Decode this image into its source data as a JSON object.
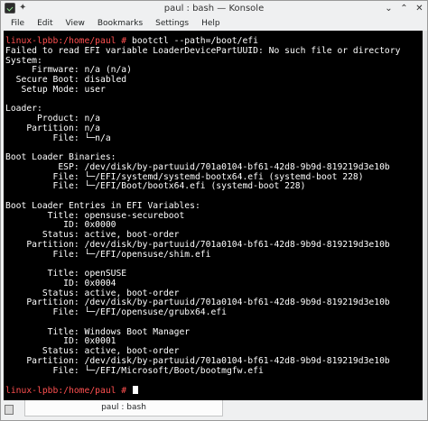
{
  "window": {
    "title": "paul : bash — Konsole",
    "min_glyph": "⌄",
    "max_glyph": "⌃",
    "close_glyph": "✕",
    "pin_glyph": "✦"
  },
  "menu": [
    "File",
    "Edit",
    "View",
    "Bookmarks",
    "Settings",
    "Help"
  ],
  "terminal": {
    "background": "#000000",
    "foreground": "#ffffff",
    "prompt_color": "#ff5050",
    "lines": [
      {
        "prompt": "linux-lpbb:/home/paul #",
        "text": " bootctl --path=/boot/efi"
      },
      {
        "text": "Failed to read EFI variable LoaderDevicePartUUID: No such file or directory"
      },
      {
        "text": "System:"
      },
      {
        "text": "     Firmware: n/a (n/a)"
      },
      {
        "text": "  Secure Boot: disabled"
      },
      {
        "text": "   Setup Mode: user"
      },
      {
        "text": ""
      },
      {
        "text": "Loader:"
      },
      {
        "text": "      Product: n/a"
      },
      {
        "text": "    Partition: n/a"
      },
      {
        "text": "         File: └─n/a"
      },
      {
        "text": ""
      },
      {
        "text": "Boot Loader Binaries:"
      },
      {
        "text": "          ESP: /dev/disk/by-partuuid/701a0104-bf61-42d8-9b9d-819219d3e10b"
      },
      {
        "text": "         File: └─/EFI/systemd/systemd-bootx64.efi (systemd-boot 228)"
      },
      {
        "text": "         File: └─/EFI/Boot/bootx64.efi (systemd-boot 228)"
      },
      {
        "text": ""
      },
      {
        "text": "Boot Loader Entries in EFI Variables:"
      },
      {
        "text": "        Title: opensuse-secureboot"
      },
      {
        "text": "           ID: 0x0000"
      },
      {
        "text": "       Status: active, boot-order"
      },
      {
        "text": "    Partition: /dev/disk/by-partuuid/701a0104-bf61-42d8-9b9d-819219d3e10b"
      },
      {
        "text": "         File: └─/EFI/opensuse/shim.efi"
      },
      {
        "text": ""
      },
      {
        "text": "        Title: openSUSE"
      },
      {
        "text": "           ID: 0x0004"
      },
      {
        "text": "       Status: active, boot-order"
      },
      {
        "text": "    Partition: /dev/disk/by-partuuid/701a0104-bf61-42d8-9b9d-819219d3e10b"
      },
      {
        "text": "         File: └─/EFI/opensuse/grubx64.efi"
      },
      {
        "text": ""
      },
      {
        "text": "        Title: Windows Boot Manager"
      },
      {
        "text": "           ID: 0x0001"
      },
      {
        "text": "       Status: active, boot-order"
      },
      {
        "text": "    Partition: /dev/disk/by-partuuid/701a0104-bf61-42d8-9b9d-819219d3e10b"
      },
      {
        "text": "         File: └─/EFI/Microsoft/Boot/bootmgfw.efi"
      },
      {
        "text": ""
      },
      {
        "prompt": "linux-lpbb:/home/paul #",
        "text": " ",
        "cursor": true
      }
    ]
  },
  "tabs": [
    {
      "label": "paul : bash"
    }
  ]
}
